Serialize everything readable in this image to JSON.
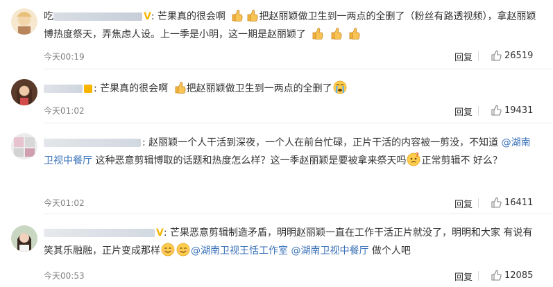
{
  "comments": [
    {
      "name_prefix": "吃",
      "segments": [
        ": 芒果真的很会啊",
        "把赵丽颖做卫生到一两点的全删了（粉丝有路透视频），",
        "拿赵丽颖博热度祭天，弄焦虑人设。上一季是小明，这一期是赵丽颖了"
      ],
      "time": "今天00:19",
      "reply": "回复",
      "likes": "26519"
    },
    {
      "segments": [
        ": 芒果真的很会啊",
        "把赵丽颖做卫生到一两点的全删了"
      ],
      "time": "今天01:02",
      "reply": "回复",
      "likes": "19431"
    },
    {
      "segments": [
        ": 赵丽颖一个人干活到深夜，一个人在前台忙碌，正片干活的内容被一剪没，不知道",
        "@湖南卫视中餐厅",
        " 这种恶意剪辑博取的话题和热度怎么样？这一季赵丽颖是要被拿来祭天吗",
        "正常剪辑不",
        "好么？"
      ],
      "time": "今天01:02",
      "reply": "回复",
      "likes": "16411"
    },
    {
      "segments": [
        ": 芒果恶意剪辑制造矛盾，明明赵丽颖一直在工作干活正片就没了，明明和大家",
        "有说有笑其乐融融，正片变成那样",
        "@湖南卫视王恬工作室",
        "@湖南卫视中餐厅",
        " 做个人吧"
      ],
      "time": "今天00:53",
      "reply": "回复",
      "likes": "12085"
    }
  ],
  "badge": "V",
  "icons": {
    "thumb": "thumbs-up-emoji",
    "cry": "crying-face-emoji",
    "confused": "confused-face-emoji",
    "smile": "smiling-face-emoji",
    "like": "like-icon"
  },
  "colors": {
    "badge": "#f7b500",
    "mention": "#3b72b8",
    "meta": "#808080"
  }
}
